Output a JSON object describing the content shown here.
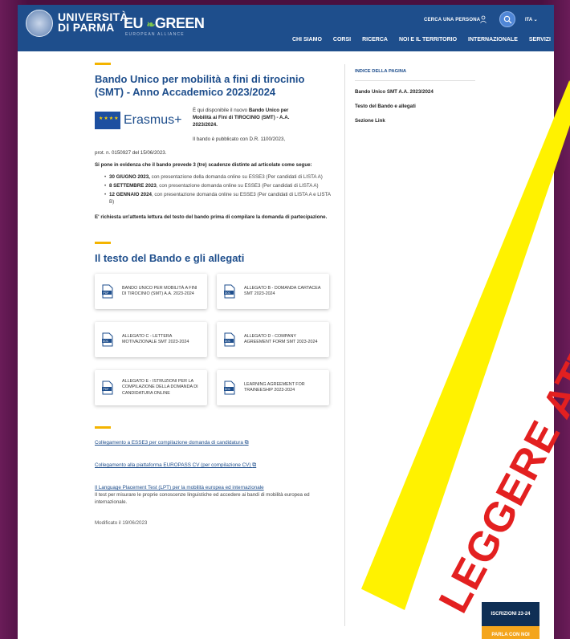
{
  "header": {
    "university_name_line1": "UNIVERSITÀ",
    "university_name_line2": "DI PARMA",
    "alliance_logo": "EU GREEN",
    "alliance_sub": "EUROPEAN ALLIANCE",
    "search_person_label": "CERCA UNA PERSONA",
    "language": "ITA",
    "nav": [
      "CHI SIAMO",
      "CORSI",
      "RICERCA",
      "NOI E IL TERRITORIO",
      "INTERNAZIONALE",
      "SERVIZI"
    ]
  },
  "main": {
    "title": "Bando Unico per mobilità a fini di tirocinio (SMT) - Anno Accademico 2023/2024",
    "erasmus_logo_text": "Erasmus+",
    "intro_prefix": "È qui disponibile il nuovo ",
    "intro_bold": "Bando Unico per Mobilità ai Fini di TIROCINIO (SMT) - A.A. 2023/2024.",
    "decree_a": "Il bando è pubblicato con D.R. 1100/2023,",
    "decree_b": "prot. n. 0150927 del 15/06/2023.",
    "deadlines_intro": "Si pone in evidenza che il bando prevede 3 (tre) scadenze distinte ad articolate come segue:",
    "deadlines": [
      {
        "date": "30 GIUGNO 2023,",
        "text": " con presentazione della domanda online su ESSE3 (Per candidati di LISTA A)"
      },
      {
        "date": "8 SETTEMBRE 2023",
        "text": ", con presentazione domanda online su ESSE3 (Per candidati di LISTA A)"
      },
      {
        "date": "12 GENNAIO 2024",
        "text": ", con presentazione domanda online su ESSE3 (Per candidati di LISTA A e LISTA B)"
      }
    ],
    "reading_note": "E' richiesta un'attenta lettura del testo del bando prima di compilare la domanda di partecipazione.",
    "section_title": "Il testo del Bando e gli allegati",
    "documents": [
      "BANDO UNICO PER MOBILITÀ A FINI DI TIROCINIO (SMT) A.A. 2023-2024",
      "ALLEGATO B - DOMANDA CARTACEA SMT 2023-2024",
      "ALLEGATO C - LETTERA MOTIVAZIONALE SMT 2023-2024",
      "ALLEGATO D - COMPANY AGREEMENT FORM SMT 2023-2024",
      "ALLEGATO E - ISTRUZIONI PER LA COMPILAZIONE DELLA DOMANDA DI CANDIDATURA ONLINE",
      "LEARNING AGREEMENT FOR TRAINEESHIP 2023-2024"
    ],
    "links": [
      {
        "text": "Collegamento a ESSE3 per compilazione domanda di candidatura",
        "desc": ""
      },
      {
        "text": "Collegamento alla piattaforma EUROPASS CV (per compilazione CV)",
        "desc": ""
      },
      {
        "text": "Il Language Placement Test (LPT) per la mobilità europea ed internazionale",
        "desc": "Il test per misurare le proprie conoscenze linguistiche ed accedere ai bandi di mobilità europea ed internazionale."
      }
    ],
    "modified": "Modificato il 19/06/2023"
  },
  "index": {
    "heading": "INDICE DELLA PAGINA",
    "items": [
      "Bando Unico SMT A.A. 2023/2024",
      "Testo del Bando e allegati",
      "Sezione Link"
    ]
  },
  "floating": {
    "iscrizioni": "ISCRIZIONI 23-24",
    "parla": "PARLA CON NOI"
  },
  "overlay": {
    "banner_text": "LEGGERE ATTENTAMENTE",
    "banner_color": "#fff200",
    "text_color": "#e32020"
  },
  "colors": {
    "brand_blue": "#1e4e8c",
    "accent_yellow": "#f4b400",
    "orange_button": "#f4a51c"
  }
}
